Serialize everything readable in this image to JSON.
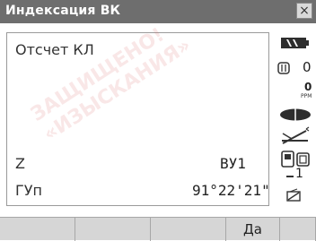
{
  "window": {
    "title": "Индексация ВК",
    "close_glyph": "×"
  },
  "content": {
    "heading": "Отсчет КЛ",
    "z_label": "Z",
    "z_value": "ВУ1",
    "hangle_label": "ГУп",
    "hangle_value": "91°22'21\""
  },
  "watermark": {
    "line1": "ЗАЩИЩЕНО!",
    "line2": "«ИЗЫСКАНИЯ»"
  },
  "sidebar": {
    "count_zero": "0",
    "ppm_value": "0",
    "ppm_label": "PPM",
    "page_number": "1"
  },
  "softkeys": [
    {
      "label": ""
    },
    {
      "label": ""
    },
    {
      "label": ""
    },
    {
      "label": "Да"
    },
    {
      "label": ""
    }
  ]
}
